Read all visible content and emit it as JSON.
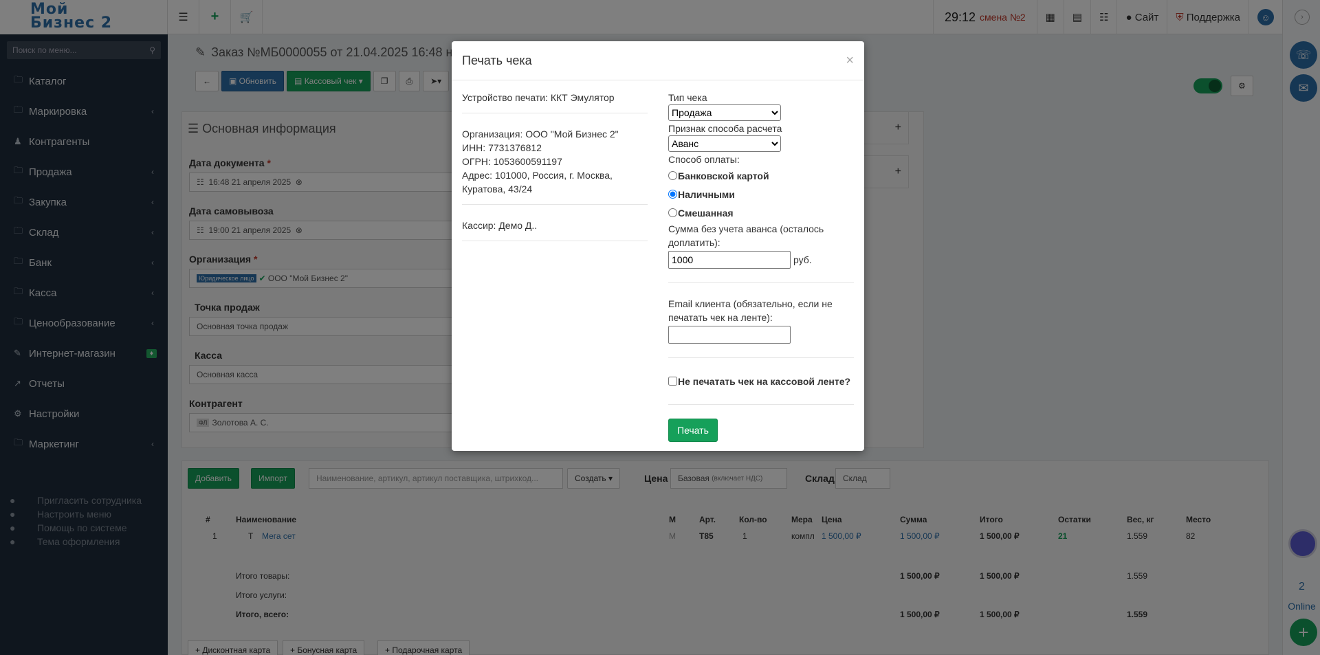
{
  "app": {
    "logo_line1": "Мой",
    "logo_line2": "Бизнес 2"
  },
  "sidebar": {
    "search_placeholder": "Поиск по меню...",
    "items": [
      {
        "label": "Каталог",
        "icon": "folder-icon",
        "chevron": false
      },
      {
        "label": "Маркировка",
        "icon": "folder-icon",
        "chevron": true
      },
      {
        "label": "Контрагенты",
        "icon": "users-icon",
        "chevron": false
      },
      {
        "label": "Продажа",
        "icon": "folder-icon",
        "chevron": true
      },
      {
        "label": "Закупка",
        "icon": "folder-icon",
        "chevron": true
      },
      {
        "label": "Склад",
        "icon": "folder-icon",
        "chevron": true
      },
      {
        "label": "Банк",
        "icon": "folder-icon",
        "chevron": true
      },
      {
        "label": "Касса",
        "icon": "folder-icon",
        "chevron": true
      },
      {
        "label": "Ценообразование",
        "icon": "folder-icon",
        "chevron": true
      },
      {
        "label": "Интернет-магазин",
        "icon": "wand-icon",
        "chevron": false
      },
      {
        "label": "Отчеты",
        "icon": "chart-icon",
        "chevron": false
      },
      {
        "label": "Настройки",
        "icon": "gear-icon",
        "chevron": false
      },
      {
        "label": "Маркетинг",
        "icon": "folder-icon",
        "chevron": true
      }
    ],
    "extras": [
      "Пригласить сотрудника",
      "Настроить меню",
      "Помощь по системе",
      "Тема оформления"
    ]
  },
  "topbar": {
    "time": "29:12",
    "shift": "смена №2",
    "site": "Сайт",
    "support": "Поддержка"
  },
  "rightbar": {
    "online_count": "2",
    "online_label": "Online"
  },
  "page": {
    "title": "Заказ №МБ0000055 от 21.04.2025 16:48 на сумму",
    "refresh": "Обновить",
    "cash_receipt": "Кассовый чек",
    "section_title": "Основная информация",
    "doc_date_label": "Дата документа",
    "doc_date": "16:48 21 апреля 2025",
    "pickup_label": "Дата самовывоза",
    "pickup_date": "19:00 21 апреля 2025",
    "org_label": "Организация",
    "org_badge": "Юридическое лицо",
    "org_value": "ООО \"Мой Бизнес 2\"",
    "pos_label": "Точка продаж",
    "pos_value": "Основная точка продаж",
    "kassa_label": "Касса",
    "kassa_value": "Основная касса",
    "contractor_label": "Контрагент",
    "contractor_badge": "ФЛ",
    "contractor_value": "Золотова А. С."
  },
  "table": {
    "add": "Добавить",
    "import": "Импорт",
    "search_placeholder": "Наименование, артикул, артикул поставщика, штрихкод...",
    "create": "Создать",
    "price_label": "Цена",
    "price_value": "Базовая",
    "price_note": "(включает НДС)",
    "stock_label": "Склад",
    "stock_value": "Склад",
    "headers": [
      "#",
      "Наименование",
      "М",
      "Арт.",
      "Кол-во",
      "Мера",
      "Цена",
      "Сумма",
      "Итого",
      "Остатки",
      "Вес, кг",
      "Место"
    ],
    "row": {
      "num": "1",
      "type": "Т",
      "name": "Мега сет",
      "m": "М",
      "art": "Т85",
      "qty": "1",
      "unit": "компл",
      "price": "1 500,00 ₽",
      "sum": "1 500,00 ₽",
      "total": "1 500,00 ₽",
      "stock": "21",
      "weight": "1.559",
      "place": "82"
    },
    "totals": [
      {
        "label": "Итого товары:",
        "sum": "1 500,00 ₽",
        "total": "1 500,00 ₽",
        "weight": "1.559"
      },
      {
        "label": "Итого услуги:",
        "sum": "",
        "total": "",
        "weight": ""
      },
      {
        "label": "Итого, всего:",
        "sum": "1 500,00 ₽",
        "total": "1 500,00 ₽",
        "weight": "1.559"
      }
    ],
    "footer_buttons": [
      "Дисконтная карта",
      "Бонусная карта",
      "Подарочная карта"
    ]
  },
  "modal": {
    "title": "Печать чека",
    "close": "×",
    "device": "Устройство печати: ККТ Эмулятор",
    "org": "Организация: ООО \"Мой Бизнес 2\"",
    "inn": "ИНН: 7731376812",
    "ogrn": "ОГРН: 1053600591197",
    "address": "Адрес: 101000, Россия, г. Москва, Куратова, 43/24",
    "cashier": "Кассир: Демо Д..",
    "receipt_type_label": "Тип чека",
    "receipt_type_value": "Продажа",
    "settlement_label": "Признак способа расчета",
    "settlement_value": "Аванс",
    "payment_label": "Способ оплаты:",
    "payment_options": [
      {
        "label": "Банковской картой",
        "checked": false
      },
      {
        "label": "Наличными",
        "checked": true
      },
      {
        "label": "Смешанная",
        "checked": false
      }
    ],
    "amount_label": "Сумма без учета аванса (осталось доплатить):",
    "amount_value": "1000",
    "currency": "руб.",
    "email_label": "Email клиента (обязательно, если не печатать чек на ленте):",
    "email_value": "",
    "no_print_label": "Не печатать чек на кассовой ленте?",
    "no_print_checked": false,
    "print_button": "Печать"
  }
}
